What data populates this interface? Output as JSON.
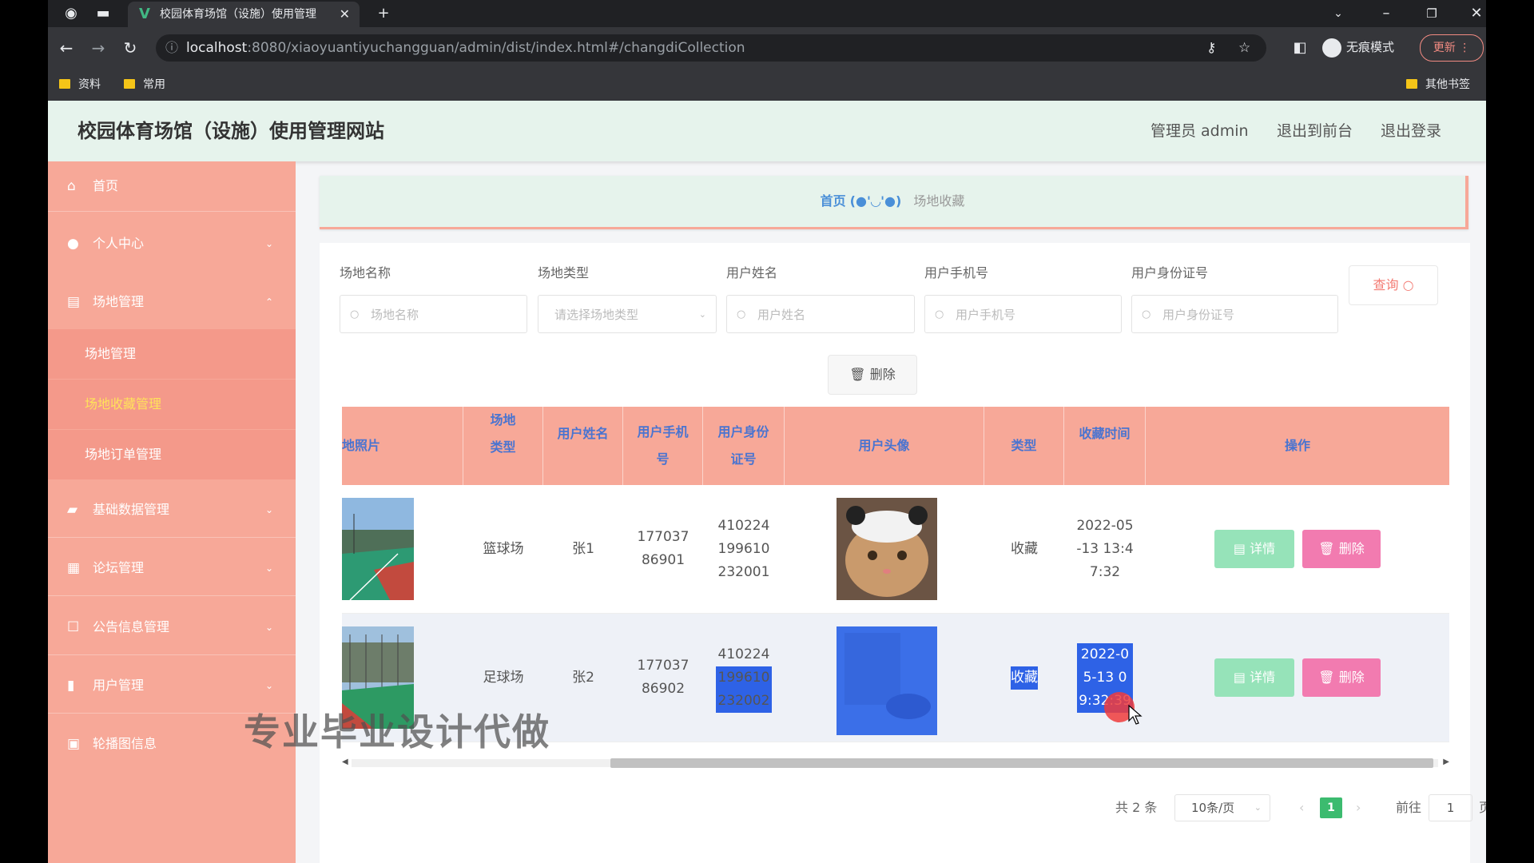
{
  "browser": {
    "tab_title": "校园体育场馆（设施）使用管理",
    "url_host": "localhost",
    "url_rest": ":8080/xiaoyuantiyuchangguan/admin/dist/index.html#/changdiCollection",
    "profile_label": "无痕模式",
    "update_label": "更新",
    "bookmarks": [
      "资料",
      "常用"
    ],
    "other_bookmarks": "其他书签"
  },
  "header": {
    "title": "校园体育场馆（设施）使用管理网站",
    "admin_label": "管理员 admin",
    "back_to_front": "退出到前台",
    "logout": "退出登录"
  },
  "sidebar": {
    "items": [
      {
        "label": "首页",
        "icon": "home-icon"
      },
      {
        "label": "个人中心",
        "icon": "user-icon"
      },
      {
        "label": "场地管理",
        "icon": "clipboard-icon"
      },
      {
        "label": "基础数据管理",
        "icon": "board-icon"
      },
      {
        "label": "论坛管理",
        "icon": "grid-icon"
      },
      {
        "label": "公告信息管理",
        "icon": "square-icon"
      },
      {
        "label": "用户管理",
        "icon": "bar-chart-icon"
      },
      {
        "label": "轮播图信息",
        "icon": "box-icon"
      }
    ],
    "sub_items": [
      "场地管理",
      "场地收藏管理",
      "场地订单管理"
    ]
  },
  "breadcrumb": {
    "home": "首页",
    "emoji": "(●'◡'●)",
    "current": "场地收藏"
  },
  "filters": [
    {
      "label": "场地名称",
      "placeholder": "场地名称"
    },
    {
      "label": "场地类型",
      "placeholder": "请选择场地类型"
    },
    {
      "label": "用户姓名",
      "placeholder": "用户姓名"
    },
    {
      "label": "用户手机号",
      "placeholder": "用户手机号"
    },
    {
      "label": "用户身份证号",
      "placeholder": "用户身份证号"
    }
  ],
  "query_label": "查询",
  "delete_label": "删除",
  "table": {
    "columns": [
      "地照片",
      "场地类型",
      "用户姓名",
      "用户手机号",
      "用户身份证号",
      "用户头像",
      "类型",
      "收藏时间",
      "操作"
    ],
    "rows": [
      {
        "type": "篮球场",
        "name": "张1",
        "phone": "17703786901",
        "id_card": "410224199610232001",
        "kind": "收藏",
        "time": "2022-05-13 13:47:32"
      },
      {
        "type": "足球场",
        "name": "张2",
        "phone": "17703786902",
        "id_card": "410224199610232002",
        "kind": "收藏",
        "time": "2022-05-13 09:32:39"
      }
    ],
    "detail_label": "详情",
    "row_delete_label": "删除"
  },
  "pagination": {
    "total": "共 2 条",
    "page_size": "10条/页",
    "current": "1",
    "goto_prefix": "前往",
    "goto_value": "1",
    "goto_suffix": "页"
  },
  "watermark": "专业毕业设计代做",
  "colors": {
    "accent": "#f7a898",
    "header_bg": "#e6f3ec",
    "link_blue": "#4a74d0",
    "detail": "#96e3b9",
    "delete": "#f27bb0",
    "pager_active": "#3cbb6f"
  }
}
